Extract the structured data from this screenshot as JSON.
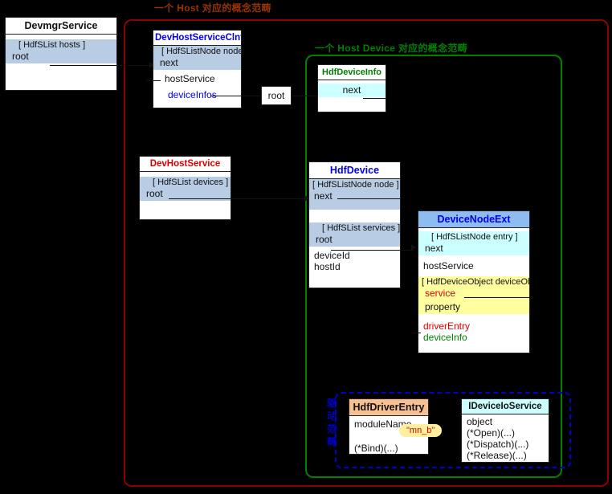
{
  "scopes": {
    "host": {
      "title": "一个 Host 对应的概念范畴",
      "color": "#993300"
    },
    "device": {
      "title": "一个 Host Device 对应的概念范畴",
      "color": "#008000"
    },
    "driver": {
      "title": "驱动范畴",
      "chars": [
        "驱",
        "动",
        "范",
        "畴"
      ],
      "color": "#0000cd"
    }
  },
  "boxes": {
    "devmgr_service": {
      "title": "DevmgrService",
      "group_head": "[ HdfSList  hosts ]",
      "field_root": "root"
    },
    "dev_host_service_clnt": {
      "title": "DevHostServiceClnt",
      "group_head": "[ HdfSListNode  node ]",
      "field_next": "next",
      "field_host_service": "hostService",
      "field_device_infos": "deviceInfos"
    },
    "dev_host_service": {
      "title": "DevHostService",
      "group_head": "[ HdfSList  devices ]",
      "field_root": "root"
    },
    "hdf_device_info": {
      "title": "HdfDeviceInfo",
      "field_next": "next"
    },
    "hdf_device": {
      "title": "HdfDevice",
      "group_head_node": "[ HdfSListNode  node ]",
      "field_next": "next",
      "group_head_services": "[ HdfSList  services ]",
      "field_root": "root",
      "field_device_id": "deviceId",
      "field_host_id": "hostId"
    },
    "device_node_ext": {
      "title": "DeviceNodeExt",
      "group_head_entry": "[ HdfSListNode  entry ]",
      "field_next": "next",
      "field_host_service": "hostService",
      "group_head_device_object": "[ HdfDeviceObject  deviceOb",
      "field_service": "service",
      "field_property": "property",
      "field_driver_entry": "driverEntry",
      "field_device_info": "deviceInfo"
    },
    "hdf_driver_entry": {
      "title": "HdfDriverEntry",
      "field_module_name": "moduleName",
      "field_bind": "(*Bind)(...)",
      "callout": "\"mn_b\""
    },
    "ideviceio_service": {
      "title": "IDeviceIoService",
      "field_object": "object",
      "field_open": "(*Open)(...)",
      "field_dispatch": "(*Dispatch)(...)",
      "field_release": "(*Release)(...)"
    },
    "root_label": {
      "text": "root"
    }
  }
}
